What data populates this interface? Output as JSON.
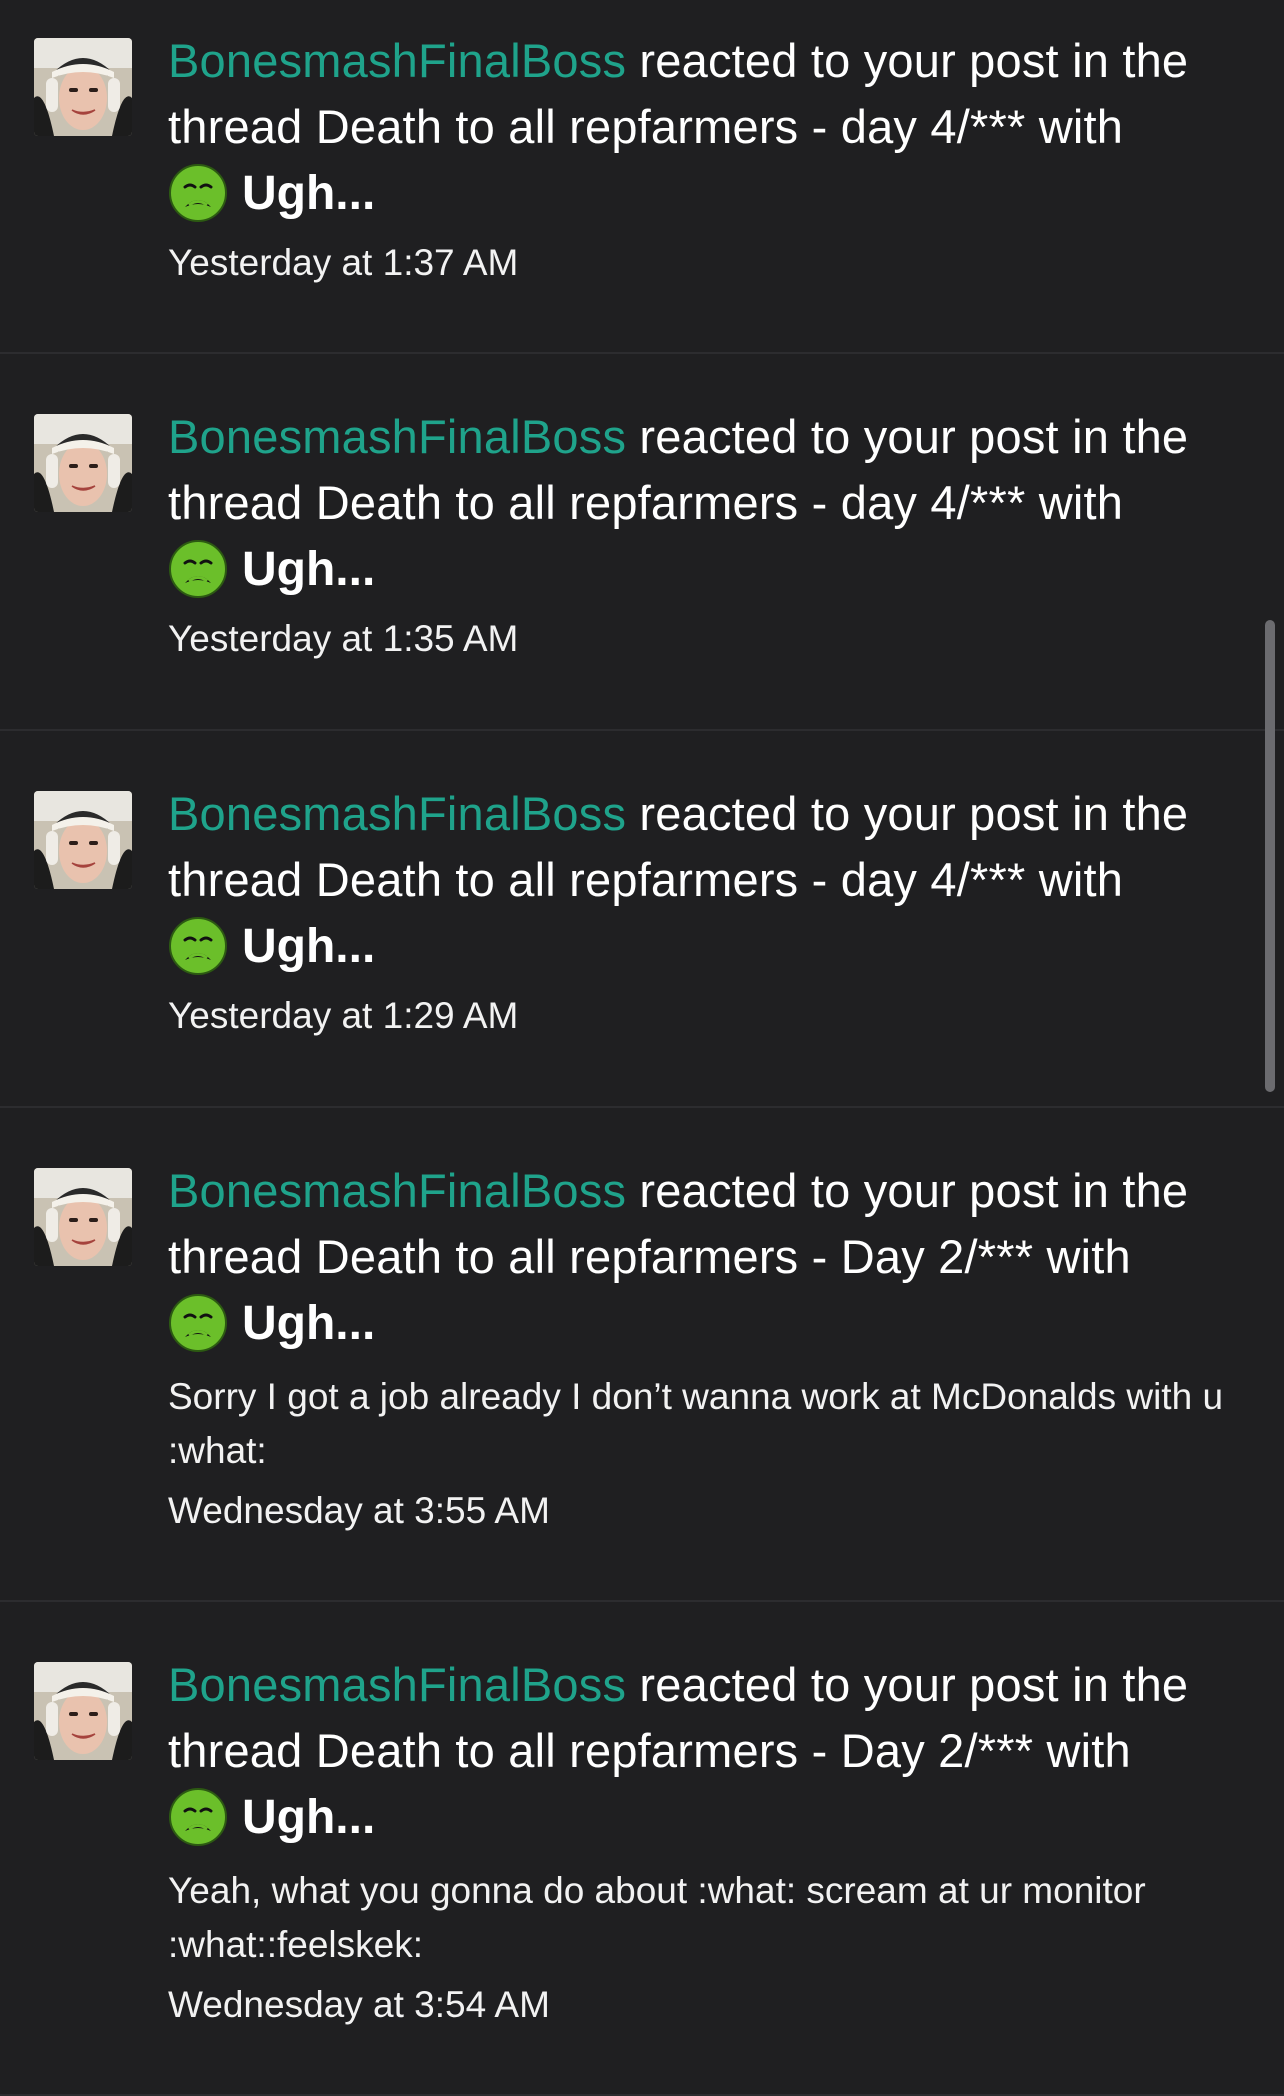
{
  "notifications": [
    {
      "user": "BonesmashFinalBoss",
      "action": " reacted to your post in the thread ",
      "thread": "Death to all repfarmers - day 4/***",
      "with": " with",
      "reaction": "Ugh...",
      "snippet": "",
      "time": "Yesterday at 1:37 AM"
    },
    {
      "user": "BonesmashFinalBoss",
      "action": " reacted to your post in the thread ",
      "thread": "Death to all repfarmers - day 4/***",
      "with": " with",
      "reaction": "Ugh...",
      "snippet": "",
      "time": "Yesterday at 1:35 AM"
    },
    {
      "user": "BonesmashFinalBoss",
      "action": " reacted to your post in the thread ",
      "thread": "Death to all repfarmers - day 4/***",
      "with": " with",
      "reaction": "Ugh...",
      "snippet": "",
      "time": "Yesterday at 1:29 AM"
    },
    {
      "user": "BonesmashFinalBoss",
      "action": " reacted to your post in the thread ",
      "thread": "Death to all repfarmers - Day 2/***",
      "with": " with",
      "reaction": "Ugh...",
      "snippet": "Sorry I got a job already I don’t wanna work at McDonalds with u :what:",
      "time": "Wednesday at 3:55 AM"
    },
    {
      "user": "BonesmashFinalBoss",
      "action": " reacted to your post in the thread ",
      "thread": "Death to all repfarmers - Day 2/***",
      "with": " with",
      "reaction": "Ugh...",
      "snippet": "Yeah, what you gonna do about :what: scream at ur monitor :what::feelskek:",
      "time": "Wednesday at 3:54 AM"
    }
  ],
  "icons": {
    "avatar": "user-avatar-photo",
    "reaction": "nauseated-face-icon"
  },
  "colors": {
    "background": "#1f1f21",
    "username": "#1fa38b",
    "text": "#ffffff",
    "divider": "#2c2c2f",
    "reaction_face": "#6bbf2a"
  }
}
